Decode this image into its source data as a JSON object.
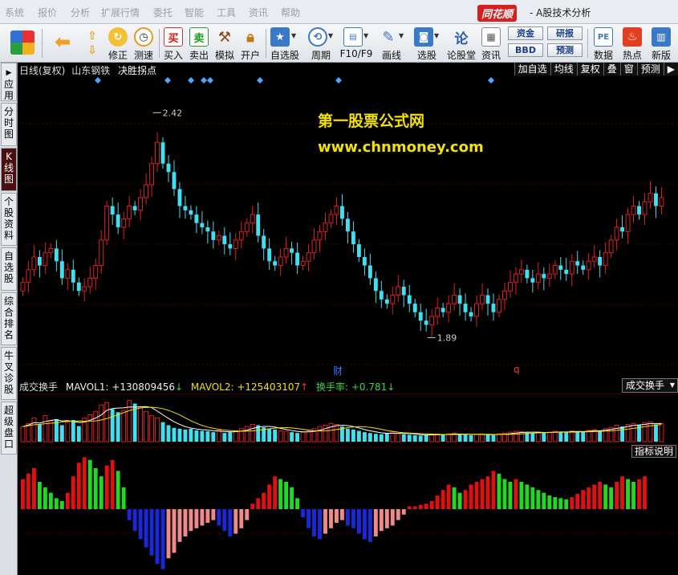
{
  "menubar": {
    "items": [
      "系统",
      "报价",
      "分析",
      "扩展行情",
      "委托",
      "智能",
      "工具",
      "资讯",
      "帮助"
    ],
    "brand": "同花顺",
    "title": "- A股技术分析"
  },
  "toolbar": {
    "buttons": [
      {
        "label": "",
        "icon": "grid-icon"
      },
      {
        "label": "",
        "icon": "back-arrow-icon"
      },
      {
        "label": "修正",
        "icon": "refresh-icon"
      },
      {
        "label": "测速",
        "icon": "clock-icon"
      },
      {
        "label": "买入",
        "icon": "buy-icon",
        "glyph": "买"
      },
      {
        "label": "卖出",
        "icon": "sell-icon",
        "glyph": "卖"
      },
      {
        "label": "模拟",
        "icon": "hammer-icon"
      },
      {
        "label": "开户",
        "icon": "lock-icon"
      },
      {
        "label": "自选股",
        "icon": "star-icon"
      },
      {
        "label": "周期",
        "icon": "cycle-icon"
      },
      {
        "label": "F10/F9",
        "icon": "f10-icon"
      },
      {
        "label": "画线",
        "icon": "pen-icon"
      },
      {
        "label": "选股",
        "icon": "select-icon"
      },
      {
        "label": "论股堂",
        "icon": "discuss-icon",
        "glyph": "论"
      },
      {
        "label": "资讯",
        "icon": "news-icon"
      },
      {
        "label": "数据",
        "icon": "pe-icon",
        "glyph": "PE"
      },
      {
        "label": "热点",
        "icon": "hot-icon"
      },
      {
        "label": "新版",
        "icon": "new-version-icon"
      }
    ],
    "small_buttons": {
      "fund": "资金",
      "research": "研报",
      "bbd": "BBD",
      "forecast": "预测"
    }
  },
  "left_tabs": [
    {
      "label": "应用",
      "active": false
    },
    {
      "label": "分时图",
      "active": false
    },
    {
      "label": "K线图",
      "active": true
    },
    {
      "label": "个股资料",
      "active": false
    },
    {
      "label": "自选股",
      "active": false
    },
    {
      "label": "综合排名",
      "active": false
    },
    {
      "label": "牛叉诊股",
      "active": false
    },
    {
      "label": "超级盘口",
      "active": false
    }
  ],
  "chart_header": {
    "period": "日线(复权)",
    "stock_name": "山东钢铁",
    "indicator": "决胜拐点"
  },
  "right_buttons": [
    "加自选",
    "均线",
    "复权",
    "叠",
    "窗",
    "预测",
    "▶"
  ],
  "watermark": {
    "line1": "第一股票公式网",
    "line2": "www.chnmoney.com"
  },
  "price_markers": {
    "high": "2.42",
    "low": "1.89"
  },
  "event_labels": {
    "fin": "财",
    "q": "q"
  },
  "volume_panel": {
    "name": "成交换手",
    "mavol1_label": "MAVOL1: +130809456",
    "mavol1_arrow": "↓",
    "mavol2_label": "MAVOL2: +125403107",
    "mavol2_arrow": "↑",
    "turnover_label": "换手率: +0.781",
    "turnover_arrow": "↓",
    "dropdown": "成交换手"
  },
  "indicator_panel": {
    "help_button": "指标说明"
  },
  "colors": {
    "up": "#e02020",
    "down": "#40e0f0",
    "ind_pos_red": "#e01010",
    "ind_pos_green": "#22d822",
    "ind_neg_blue": "#1a28d8",
    "ind_neg_pink": "#f08a8a",
    "watermark": "#f3e100",
    "marker": "#4aa8ff"
  },
  "chart_data": {
    "type": "candlestick",
    "y_range": [
      1.8,
      2.5
    ],
    "high_marker": 2.42,
    "low_marker": 1.89,
    "price_path": [
      2.02,
      2.05,
      2.08,
      2.06,
      2.09,
      2.1,
      2.07,
      2.03,
      2.05,
      2.02,
      2.0,
      2.01,
      2.03,
      2.06,
      2.12,
      2.2,
      2.18,
      2.15,
      2.17,
      2.2,
      2.19,
      2.22,
      2.25,
      2.3,
      2.35,
      2.3,
      2.28,
      2.24,
      2.2,
      2.19,
      2.18,
      2.16,
      2.15,
      2.14,
      2.12,
      2.13,
      2.11,
      2.1,
      2.12,
      2.14,
      2.16,
      2.18,
      2.13,
      2.1,
      2.07,
      2.06,
      2.08,
      2.1,
      2.09,
      2.06,
      2.07,
      2.09,
      2.12,
      2.14,
      2.16,
      2.18,
      2.2,
      2.17,
      2.14,
      2.11,
      2.08,
      2.06,
      2.03,
      2.0,
      1.98,
      1.97,
      1.99,
      2.01,
      1.99,
      1.97,
      1.95,
      1.93,
      1.92,
      1.94,
      1.96,
      1.95,
      1.97,
      1.99,
      1.97,
      1.95,
      1.94,
      1.97,
      1.99,
      1.97,
      1.95,
      1.98,
      2.0,
      2.02,
      2.04,
      2.05,
      2.03,
      2.02,
      2.04,
      2.03,
      2.04,
      2.06,
      2.05,
      2.04,
      2.07,
      2.06,
      2.05,
      2.07,
      2.08,
      2.06,
      2.09,
      2.12,
      2.15,
      2.14,
      2.18,
      2.2,
      2.18,
      2.21,
      2.23,
      2.2,
      2.22
    ],
    "marker_positions": [
      100,
      187,
      216,
      232,
      240,
      302,
      400,
      590
    ],
    "volume": [
      0.35,
      0.42,
      0.55,
      0.4,
      0.6,
      0.48,
      0.52,
      0.38,
      0.45,
      0.5,
      0.36,
      0.55,
      0.62,
      0.7,
      0.85,
      0.9,
      0.75,
      0.68,
      0.72,
      0.95,
      0.88,
      0.8,
      0.7,
      0.6,
      0.55,
      0.45,
      0.38,
      0.32,
      0.3,
      0.28,
      0.3,
      0.26,
      0.25,
      0.24,
      0.22,
      0.26,
      0.2,
      0.22,
      0.25,
      0.3,
      0.35,
      0.4,
      0.38,
      0.33,
      0.3,
      0.28,
      0.25,
      0.24,
      0.22,
      0.2,
      0.22,
      0.25,
      0.3,
      0.35,
      0.38,
      0.42,
      0.4,
      0.35,
      0.3,
      0.28,
      0.25,
      0.22,
      0.2,
      0.18,
      0.17,
      0.2,
      0.22,
      0.19,
      0.17,
      0.16,
      0.15,
      0.14,
      0.16,
      0.18,
      0.17,
      0.16,
      0.18,
      0.2,
      0.17,
      0.16,
      0.15,
      0.17,
      0.18,
      0.16,
      0.15,
      0.18,
      0.2,
      0.22,
      0.24,
      0.23,
      0.21,
      0.2,
      0.22,
      0.21,
      0.22,
      0.24,
      0.23,
      0.22,
      0.25,
      0.24,
      0.23,
      0.26,
      0.28,
      0.25,
      0.3,
      0.33,
      0.38,
      0.35,
      0.4,
      0.42,
      0.38,
      0.44,
      0.46,
      0.4,
      0.42
    ],
    "indicator": [
      0.55,
      0.65,
      0.75,
      0.5,
      0.4,
      0.3,
      0.2,
      0.15,
      0.3,
      0.6,
      0.85,
      0.95,
      0.9,
      0.75,
      0.6,
      0.8,
      0.9,
      0.7,
      0.4,
      -0.2,
      -0.4,
      -0.55,
      -0.7,
      -0.85,
      -1.0,
      -1.1,
      -0.9,
      -0.8,
      -0.6,
      -0.5,
      -0.4,
      -0.35,
      -0.3,
      -0.25,
      -0.2,
      -0.3,
      -0.4,
      -0.5,
      -0.45,
      -0.35,
      -0.2,
      0.1,
      0.2,
      0.3,
      0.45,
      0.6,
      0.55,
      0.5,
      0.4,
      0.2,
      -0.15,
      -0.35,
      -0.5,
      -0.55,
      -0.45,
      -0.35,
      -0.25,
      -0.2,
      -0.3,
      -0.35,
      -0.45,
      -0.55,
      -0.6,
      -0.5,
      -0.4,
      -0.35,
      -0.3,
      -0.2,
      -0.1,
      0.05,
      0.05,
      0.08,
      0.1,
      0.15,
      0.25,
      0.35,
      0.45,
      0.4,
      0.3,
      0.35,
      0.45,
      0.5,
      0.55,
      0.6,
      0.7,
      0.65,
      0.55,
      0.5,
      0.55,
      0.5,
      0.45,
      0.4,
      0.35,
      0.3,
      0.25,
      0.22,
      0.2,
      0.18,
      0.22,
      0.28,
      0.35,
      0.4,
      0.45,
      0.5,
      0.45,
      0.4,
      0.5,
      0.6,
      0.55,
      0.5,
      0.55,
      0.6
    ]
  }
}
